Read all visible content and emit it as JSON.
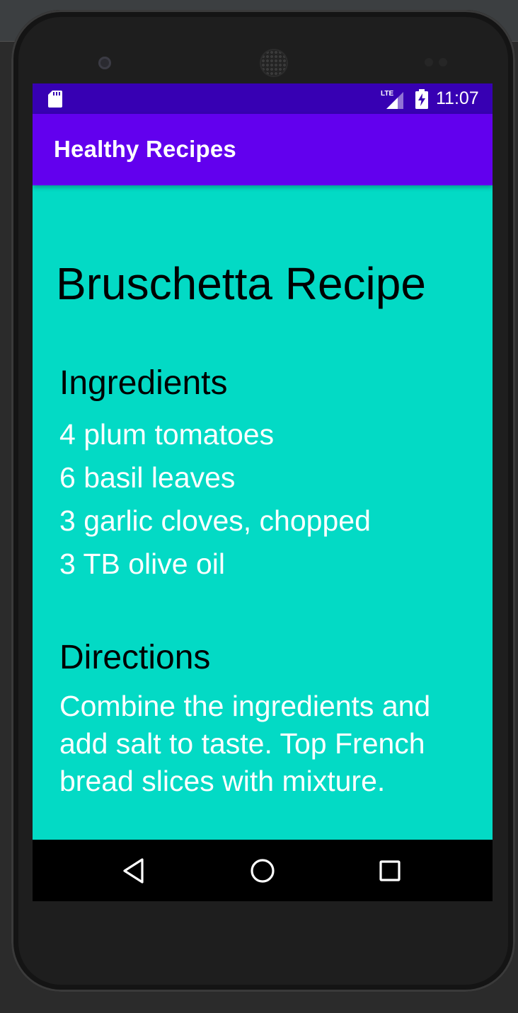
{
  "status_bar": {
    "time": "11:07",
    "network_label": "LTE",
    "icons": [
      "sd-card-icon",
      "lte-signal-icon",
      "battery-charging-icon"
    ]
  },
  "app_bar": {
    "title": "Healthy Recipes"
  },
  "recipe": {
    "title": "Bruschetta Recipe",
    "ingredients_heading": "Ingredients",
    "ingredients": [
      "4 plum tomatoes",
      "6 basil leaves",
      "3 garlic cloves, chopped",
      "3 TB olive oil"
    ],
    "directions_heading": "Directions",
    "directions": "Combine the ingredients and add salt to taste. Top French bread slices with mixture."
  },
  "nav_bar": {
    "icons": [
      "back-triangle-icon",
      "home-circle-icon",
      "recents-square-icon"
    ]
  },
  "colors": {
    "status_bar": "#3700b3",
    "app_bar": "#6200ee",
    "content_background": "#03dac5",
    "heading_text": "#000000",
    "body_text": "#ffffff",
    "nav_bar": "#000000"
  }
}
